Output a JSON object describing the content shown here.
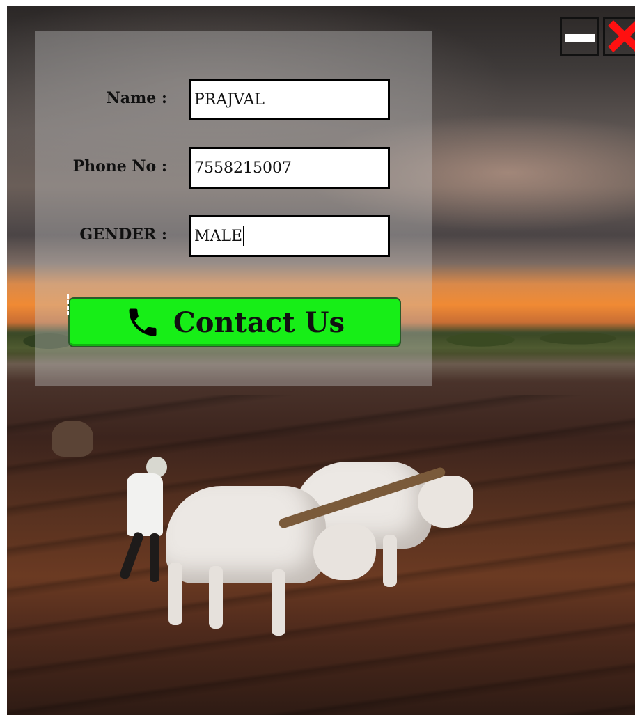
{
  "form": {
    "name_label": "Name :",
    "name_value": "PRAJVAL",
    "phone_label": "Phone No :",
    "phone_value": "7558215007",
    "gender_label": "GENDER :",
    "gender_value": "MALE"
  },
  "contact_button": {
    "label": "Contact Us",
    "icon": "phone-icon",
    "color": "#17ee17"
  },
  "window_controls": {
    "minimize_icon": "minimize-icon",
    "close_icon": "close-icon",
    "close_color": "#ff1010"
  }
}
